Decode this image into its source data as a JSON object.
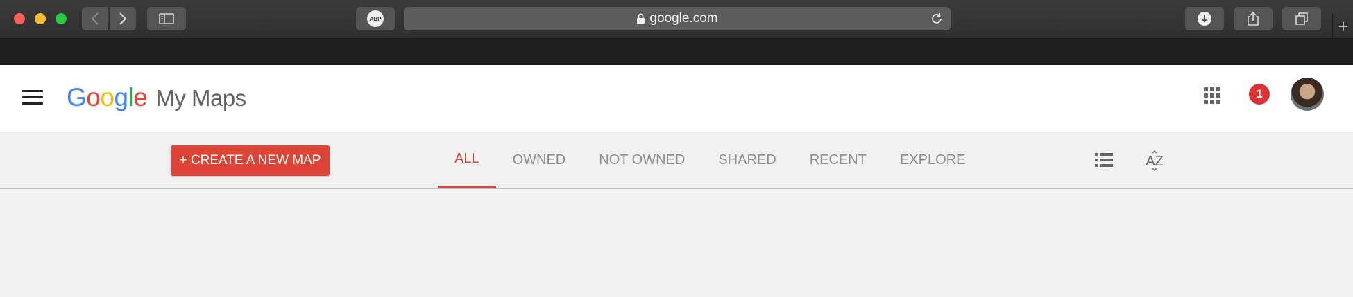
{
  "browser": {
    "url": "google.com",
    "abp_label": "ABP"
  },
  "app": {
    "logo_letters": [
      "G",
      "o",
      "o",
      "g",
      "l",
      "e"
    ],
    "product_name": "My Maps",
    "notification_count": "1"
  },
  "toolbar": {
    "create_label": "+ CREATE A NEW MAP",
    "tabs": [
      {
        "label": "ALL",
        "active": true
      },
      {
        "label": "OWNED"
      },
      {
        "label": "NOT OWNED"
      },
      {
        "label": "SHARED"
      },
      {
        "label": "RECENT"
      },
      {
        "label": "EXPLORE"
      }
    ],
    "sort_label": "AZ"
  },
  "colors": {
    "accent": "#db4437",
    "notification": "#db3236"
  }
}
